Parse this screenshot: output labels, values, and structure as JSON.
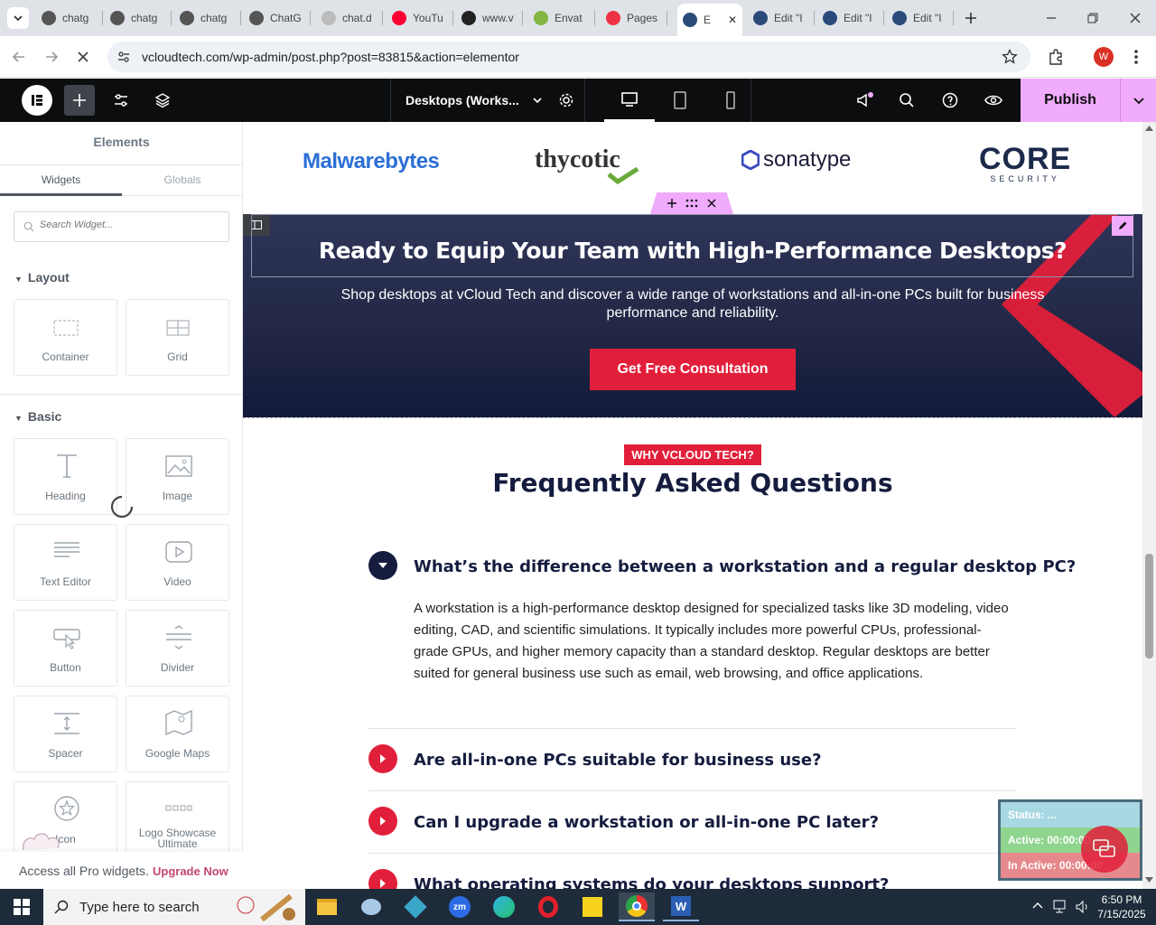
{
  "browser": {
    "tabs": [
      {
        "label": "chatg",
        "icon": "chatgpt-icon"
      },
      {
        "label": "chatg",
        "icon": "chatgpt-icon"
      },
      {
        "label": "chatg",
        "icon": "chatgpt-icon"
      },
      {
        "label": "ChatG",
        "icon": "chatgpt-icon"
      },
      {
        "label": "chat.d",
        "icon": "deepseek-icon"
      },
      {
        "label": "YouTu",
        "icon": "youtube-icon"
      },
      {
        "label": "www.v",
        "icon": "wordpress-icon"
      },
      {
        "label": "Envat",
        "icon": "envato-icon"
      },
      {
        "label": "Pages",
        "icon": "pages-icon"
      },
      {
        "label": "E",
        "icon": "vcloud-icon"
      },
      {
        "label": "Edit \"I",
        "icon": "vcloud-icon"
      },
      {
        "label": "Edit \"I",
        "icon": "vcloud-icon"
      },
      {
        "label": "Edit \"I",
        "icon": "vcloud-icon"
      }
    ],
    "url": "vcloudtech.com/wp-admin/post.php?post=83815&action=elementor",
    "profile_initial": "W"
  },
  "editor": {
    "device_label": "Desktops (Works...",
    "publish_label": "Publish"
  },
  "panel": {
    "title": "Elements",
    "tab_widgets": "Widgets",
    "tab_globals": "Globals",
    "search_placeholder": "Search Widget...",
    "section_layout": "Layout",
    "section_basic": "Basic",
    "layout_widgets": [
      "Container",
      "Grid"
    ],
    "basic_widgets": [
      "Heading",
      "Image",
      "Text Editor",
      "Video",
      "Button",
      "Divider",
      "Spacer",
      "Google Maps",
      "Icon",
      "Logo Showcase Ultimate"
    ],
    "pro_text": "Access all Pro widgets.",
    "upgrade_label": "Upgrade Now"
  },
  "page": {
    "logos": [
      "Malwarebytes",
      "thycotic",
      "sonatype",
      "CORE",
      "SECURITY"
    ],
    "cta_heading": "Ready to Equip Your Team with High-Performance Desktops?",
    "cta_text": "Shop desktops at vCloud Tech and discover a wide range of workstations and all-in-one PCs built for business performance and reliability.",
    "cta_button": "Get Free Consultation",
    "faq_badge": "WHY VCLOUD TECH?",
    "faq_title": "Frequently Asked Questions",
    "faq": [
      {
        "q": "What’s the difference between a workstation and a regular desktop PC?",
        "open": true,
        "a": "A workstation is a high-performance desktop designed for specialized tasks like 3D modeling, video editing, CAD, and scientific simulations. It typically includes more powerful CPUs, professional-grade GPUs, and higher memory capacity than a standard desktop. Regular desktops are better suited for general business use such as email, web browsing, and office applications."
      },
      {
        "q": "Are all-in-one PCs suitable for business use?",
        "open": false
      },
      {
        "q": "Can I upgrade a workstation or all-in-one PC later?",
        "open": false
      },
      {
        "q": "What operating systems do your desktops support?",
        "open": false
      }
    ]
  },
  "status_widget": {
    "status": "Status: ...",
    "active": "Active: 00:00:00",
    "inactive": "In Active: 00:00:00"
  },
  "taskbar": {
    "search_placeholder": "Type here to search",
    "time": "6:50 PM",
    "date": "7/15/2025"
  },
  "colors": {
    "accent_red": "#e21f3a",
    "navy": "#151c3e",
    "elementor_pink": "#f0abfc"
  }
}
